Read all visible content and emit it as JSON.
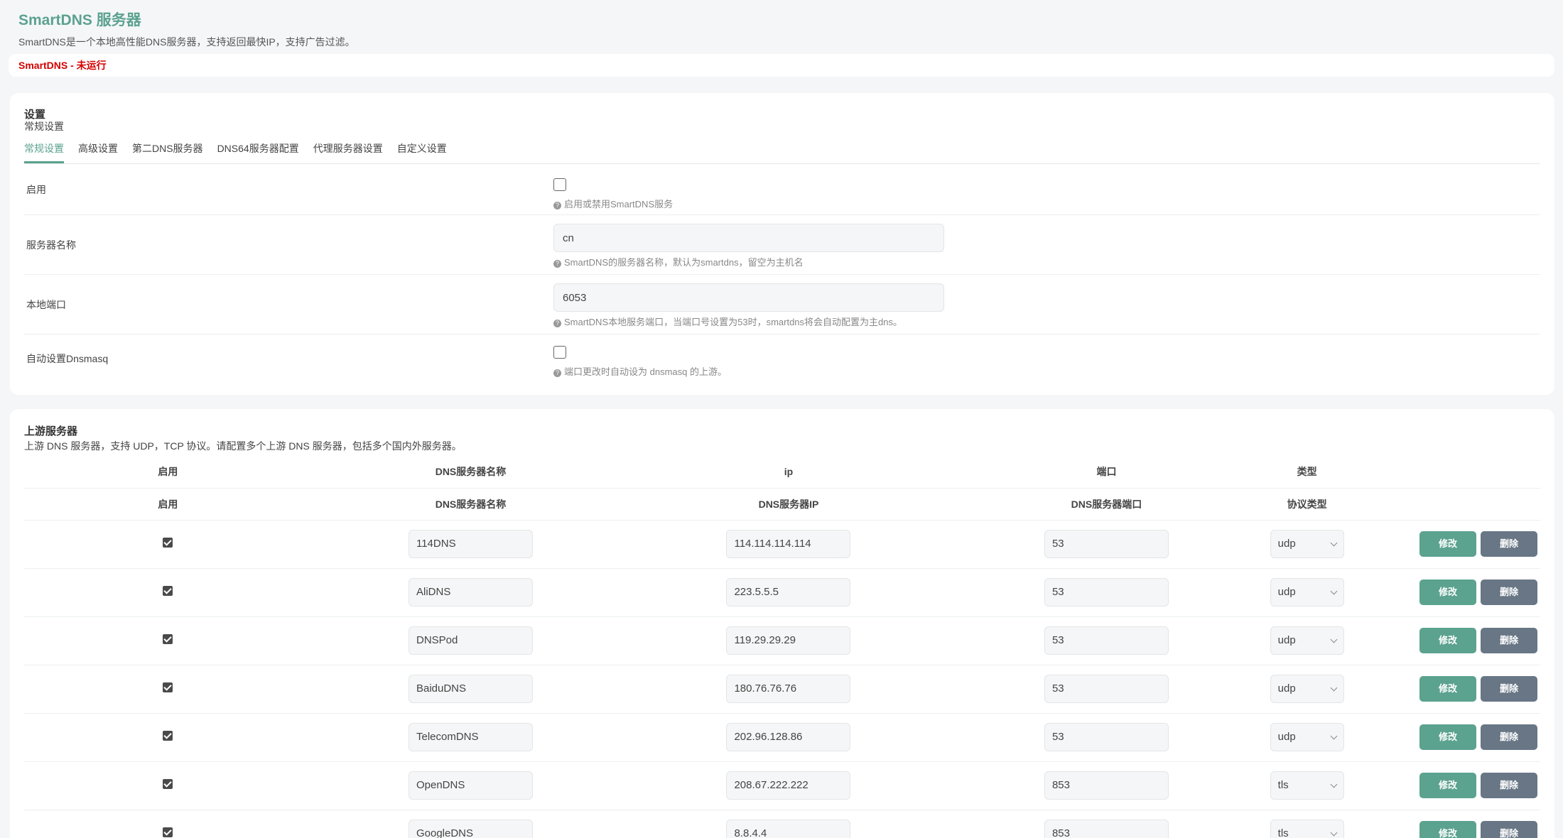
{
  "app": {
    "title": "SmartDNS 服务器",
    "description": "SmartDNS是一个本地高性能DNS服务器，支持返回最快IP，支持广告过滤。",
    "status": "SmartDNS - 未运行"
  },
  "settings": {
    "title": "设置",
    "subtitle": "常规设置",
    "tabs": [
      "常规设置",
      "高级设置",
      "第二DNS服务器",
      "DNS64服务器配置",
      "代理服务器设置",
      "自定义设置"
    ],
    "fields": {
      "enable": {
        "label": "启用",
        "checked": false,
        "hint": "启用或禁用SmartDNS服务"
      },
      "server_name": {
        "label": "服务器名称",
        "value": "cn",
        "hint": "SmartDNS的服务器名称，默认为smartdns，留空为主机名"
      },
      "local_port": {
        "label": "本地端口",
        "value": "6053",
        "hint": "SmartDNS本地服务端口，当端口号设置为53时，smartdns将会自动配置为主dns。"
      },
      "auto_dnsmasq": {
        "label": "自动设置Dnsmasq",
        "checked": false,
        "hint": "端口更改时自动设为 dnsmasq 的上游。"
      }
    }
  },
  "upstream": {
    "title": "上游服务器",
    "description": "上游 DNS 服务器，支持 UDP，TCP 协议。请配置多个上游 DNS 服务器，包括多个国内外服务器。",
    "headers": {
      "enable": "启用",
      "name": "DNS服务器名称",
      "ip": "ip",
      "port": "端口",
      "type": "类型"
    },
    "subheaders": {
      "enable": "启用",
      "name": "DNS服务器名称",
      "ip": "DNS服务器IP",
      "port": "DNS服务器端口",
      "type": "协议类型"
    },
    "edit_label": "修改",
    "delete_label": "删除",
    "rows": [
      {
        "enabled": true,
        "name": "114DNS",
        "ip": "114.114.114.114",
        "port": "53",
        "type": "udp"
      },
      {
        "enabled": true,
        "name": "AliDNS",
        "ip": "223.5.5.5",
        "port": "53",
        "type": "udp"
      },
      {
        "enabled": true,
        "name": "DNSPod",
        "ip": "119.29.29.29",
        "port": "53",
        "type": "udp"
      },
      {
        "enabled": true,
        "name": "BaiduDNS",
        "ip": "180.76.76.76",
        "port": "53",
        "type": "udp"
      },
      {
        "enabled": true,
        "name": "TelecomDNS",
        "ip": "202.96.128.86",
        "port": "53",
        "type": "udp"
      },
      {
        "enabled": true,
        "name": "OpenDNS",
        "ip": "208.67.222.222",
        "port": "853",
        "type": "tls"
      },
      {
        "enabled": true,
        "name": "GoogleDNS",
        "ip": "8.8.4.4",
        "port": "853",
        "type": "tls"
      }
    ]
  },
  "colors": {
    "accent": "#5ba28f",
    "status_red": "#d40000",
    "delete_gray": "#687685"
  }
}
